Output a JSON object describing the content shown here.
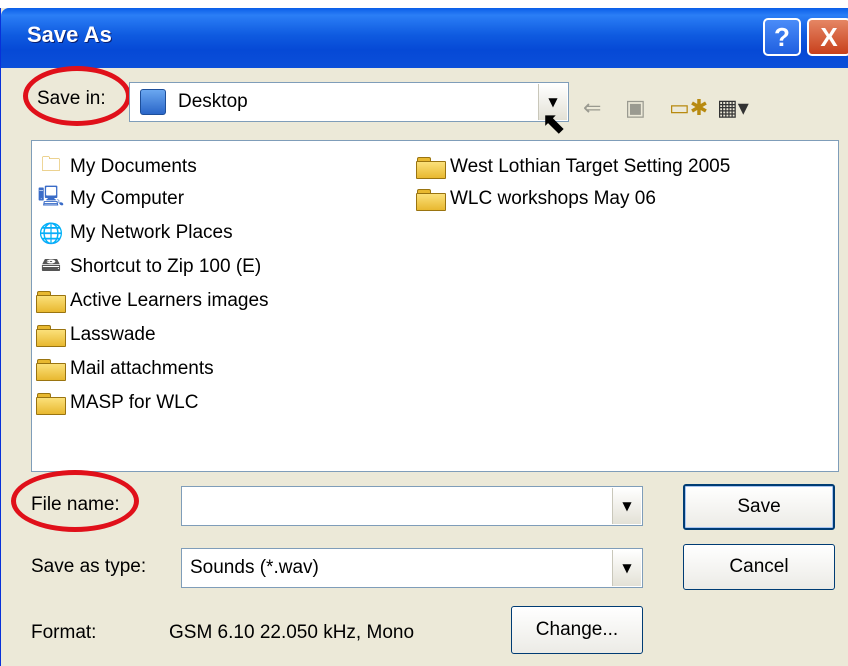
{
  "window": {
    "title": "Save As"
  },
  "titlebar": {
    "help_label": "?",
    "close_label": "X"
  },
  "save_in": {
    "label": "Save in:",
    "value": "Desktop"
  },
  "toolbar": {
    "icons": [
      "back-icon",
      "up-folder-icon",
      "new-folder-icon",
      "view-menu-icon"
    ]
  },
  "files": {
    "left_column": [
      {
        "name": "My Documents",
        "icon": "my-documents-icon"
      },
      {
        "name": "My Computer",
        "icon": "my-computer-icon"
      },
      {
        "name": "My Network Places",
        "icon": "network-places-icon"
      },
      {
        "name": "Shortcut to Zip 100  (E)",
        "icon": "zip-drive-icon"
      },
      {
        "name": "Active Learners images",
        "icon": "folder-icon"
      },
      {
        "name": "Lasswade",
        "icon": "folder-icon"
      },
      {
        "name": "Mail attachments",
        "icon": "folder-icon"
      },
      {
        "name": "MASP for WLC",
        "icon": "folder-icon"
      }
    ],
    "right_column": [
      {
        "name": "West Lothian Target Setting 2005",
        "icon": "folder-icon"
      },
      {
        "name": "WLC workshops May 06",
        "icon": "folder-icon"
      }
    ]
  },
  "file_name": {
    "label": "File name:",
    "value": ""
  },
  "save_as_type": {
    "label": "Save as type:",
    "value": "Sounds (*.wav)"
  },
  "format": {
    "label": "Format:",
    "value": "GSM 6.10 22.050 kHz, Mono"
  },
  "buttons": {
    "save": "Save",
    "cancel": "Cancel",
    "change": "Change..."
  },
  "colors": {
    "titlebar": "#0b4fd9",
    "highlight_ring": "#e0101a",
    "dialog_bg": "#ece9d8"
  }
}
